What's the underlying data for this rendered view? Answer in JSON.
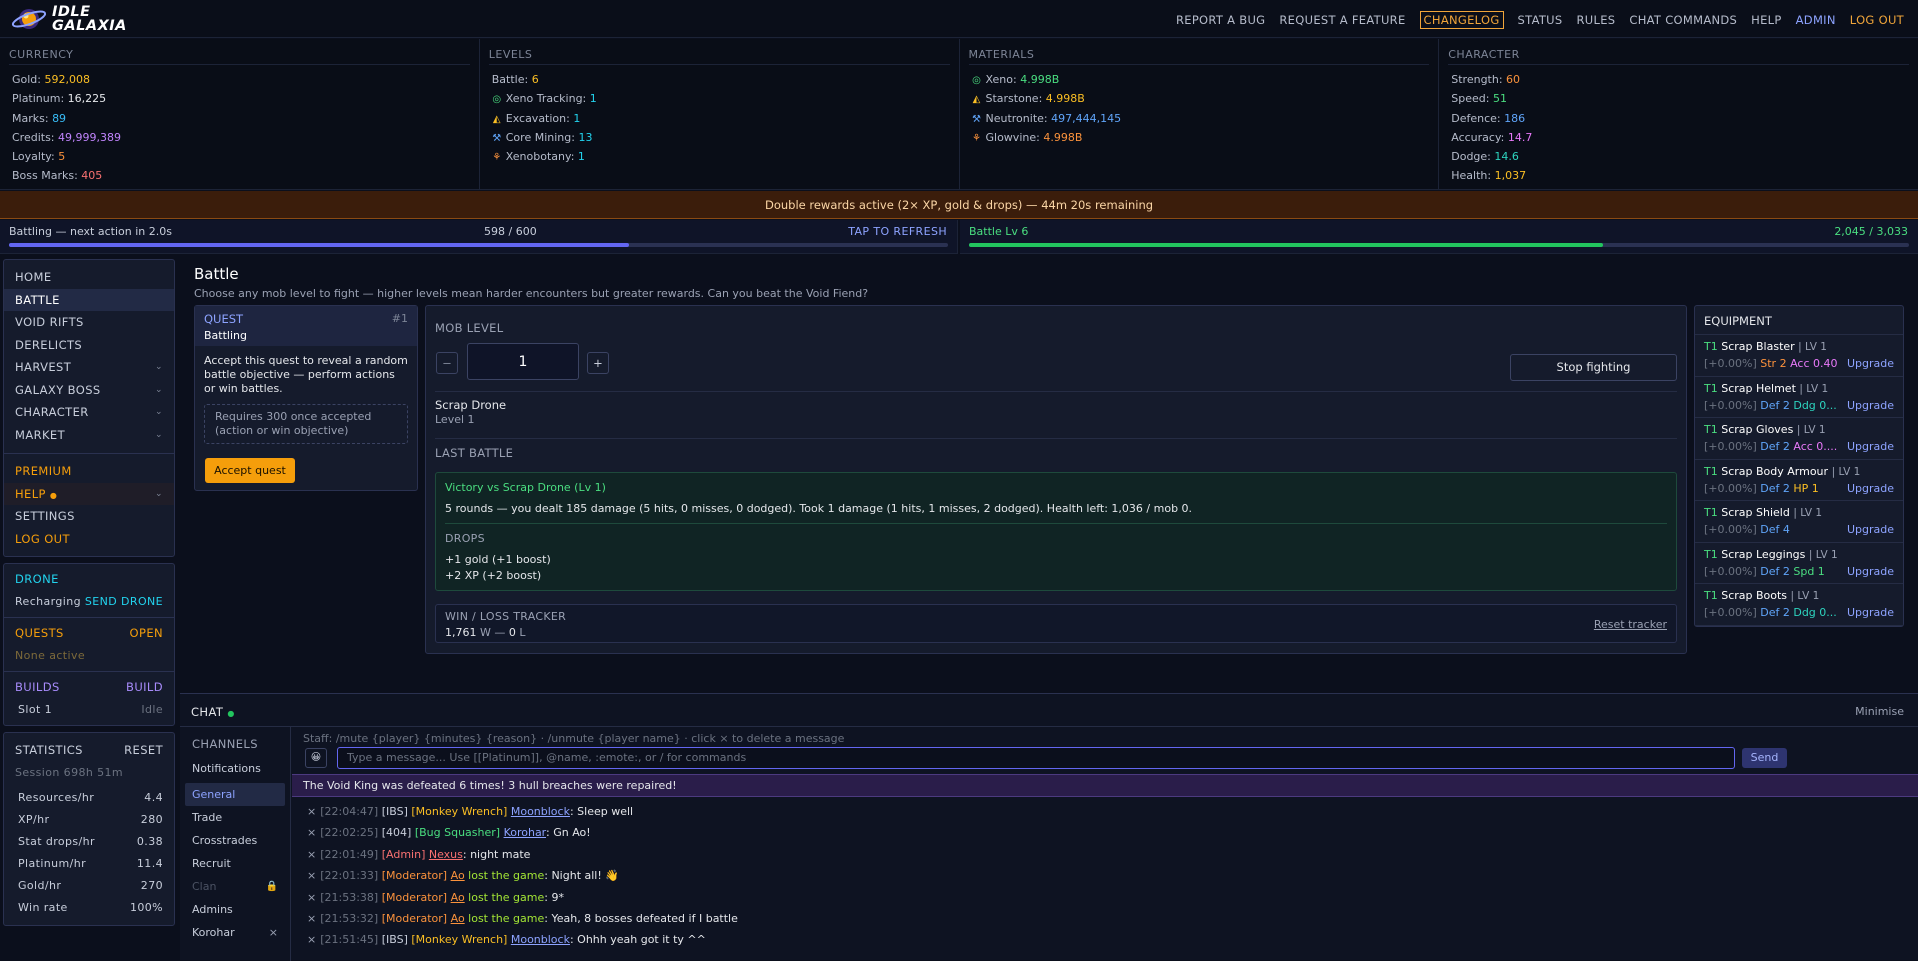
{
  "brand": {
    "line1": "IDLE",
    "line2": "GALAXIA"
  },
  "nav": [
    "REPORT A BUG",
    "REQUEST A FEATURE",
    "CHANGELOG",
    "STATUS",
    "RULES",
    "CHAT COMMANDS",
    "HELP",
    "ADMIN",
    "LOG OUT"
  ],
  "currency": {
    "title": "CURRENCY",
    "rows": [
      {
        "k": "Gold:",
        "v": "592,008",
        "c": "#fbbf24"
      },
      {
        "k": "Platinum:",
        "v": "16,225",
        "c": "#e5e7eb"
      },
      {
        "k": "Marks:",
        "v": "89",
        "c": "#38bdf8"
      },
      {
        "k": "Credits:",
        "v": "49,999,389",
        "c": "#c084fc"
      },
      {
        "k": "Loyalty:",
        "v": "5",
        "c": "#fb923c"
      },
      {
        "k": "Boss Marks:",
        "v": "405",
        "c": "#f87171"
      }
    ]
  },
  "levels": {
    "title": "LEVELS",
    "rows": [
      {
        "icon": "",
        "k": "Battle:",
        "v": "6",
        "c": "#fbbf24"
      },
      {
        "icon": "◎",
        "ic": "#4ade80",
        "k": "Xeno Tracking:",
        "v": "1",
        "c": "#22d3ee"
      },
      {
        "icon": "◭",
        "ic": "#fbbf24",
        "k": "Excavation:",
        "v": "1",
        "c": "#22d3ee"
      },
      {
        "icon": "⚒",
        "ic": "#60a5fa",
        "k": "Core Mining:",
        "v": "13",
        "c": "#22d3ee"
      },
      {
        "icon": "⚘",
        "ic": "#fb923c",
        "k": "Xenobotany:",
        "v": "1",
        "c": "#22d3ee"
      }
    ]
  },
  "materials": {
    "title": "MATERIALS",
    "rows": [
      {
        "icon": "◎",
        "ic": "#4ade80",
        "k": "Xeno:",
        "v": "4.998B",
        "c": "#4ade80"
      },
      {
        "icon": "◭",
        "ic": "#fbbf24",
        "k": "Starstone:",
        "v": "4.998B",
        "c": "#fbbf24"
      },
      {
        "icon": "⚒",
        "ic": "#60a5fa",
        "k": "Neutronite:",
        "v": "497,444,145",
        "c": "#60a5fa"
      },
      {
        "icon": "⚘",
        "ic": "#fb923c",
        "k": "Glowvine:",
        "v": "4.998B",
        "c": "#fb923c"
      }
    ]
  },
  "character": {
    "title": "CHARACTER",
    "rows": [
      {
        "k": "Strength:",
        "v": "60",
        "c": "#fb923c"
      },
      {
        "k": "Speed:",
        "v": "51",
        "c": "#4ade80"
      },
      {
        "k": "Defence:",
        "v": "186",
        "c": "#60a5fa"
      },
      {
        "k": "Accuracy:",
        "v": "14.7",
        "c": "#e879f9"
      },
      {
        "k": "Dodge:",
        "v": "14.6",
        "c": "#2dd4bf"
      },
      {
        "k": "Health:",
        "v": "1,037",
        "c": "#fbbf24"
      }
    ]
  },
  "banner": "Double rewards active (2× XP, gold & drops) — 44m 20s remaining",
  "progress": {
    "action": "Battling — next action in 2.0s",
    "count": "598 / 600",
    "refresh": "TAP TO REFRESH",
    "action_frac": 0.66,
    "level_label": "Battle Lv 6",
    "level_count": "2,045 / 3,033",
    "level_frac": 0.674
  },
  "menu": {
    "main": [
      "HOME",
      "BATTLE",
      "VOID RIFTS",
      "DERELICTS",
      "HARVEST",
      "GALAXY BOSS",
      "CHARACTER",
      "MARKET"
    ],
    "extra": [
      "PREMIUM",
      "HELP",
      "SETTINGS",
      "LOG OUT"
    ]
  },
  "drone": {
    "title": "DRONE",
    "status": "Recharging",
    "action": "SEND DRONE"
  },
  "quests": {
    "title": "QUESTS",
    "action": "OPEN",
    "status": "None active"
  },
  "builds": {
    "title": "BUILDS",
    "action": "BUILD",
    "slot": "Slot 1",
    "state": "Idle"
  },
  "statistics": {
    "title": "STATISTICS",
    "reset": "RESET",
    "session": "Session 698h 51m",
    "rows": [
      {
        "k": "Resources/hr",
        "v": "4.4"
      },
      {
        "k": "XP/hr",
        "v": "280"
      },
      {
        "k": "Stat drops/hr",
        "v": "0.38"
      },
      {
        "k": "Platinum/hr",
        "v": "11.4"
      },
      {
        "k": "Gold/hr",
        "v": "270"
      },
      {
        "k": "Win rate",
        "v": "100%"
      }
    ]
  },
  "page": {
    "title": "Battle",
    "subtitle": "Choose any mob level to fight — higher levels mean harder encounters but greater rewards. Can you beat the Void Fiend?"
  },
  "quest_card": {
    "label": "QUEST",
    "num": "#1",
    "type": "Battling",
    "desc": "Accept this quest to reveal a random battle objective — perform actions or win battles.",
    "req": "Requires 300 once accepted (action or win objective)",
    "button": "Accept quest"
  },
  "battle": {
    "mob_level_label": "MOB LEVEL",
    "minus": "−",
    "plus": "+",
    "mob_level": "1",
    "stop": "Stop fighting",
    "mob_name": "Scrap Drone",
    "mob_lvl": "Level 1",
    "last_battle": "LAST BATTLE",
    "result": "Victory vs Scrap Drone (Lv 1)",
    "summary": "5 rounds — you dealt 185 damage (5 hits, 0 misses, 0 dodged). Took 1 damage (1 hits, 1 misses, 2 dodged). Health left: 1,036 / mob 0.",
    "drops_label": "DROPS",
    "drops": [
      "+1 gold (+1 boost)",
      "+2 XP (+2 boost)"
    ],
    "tracker_label": "WIN / LOSS TRACKER",
    "wins": "1,761",
    "w": "W",
    "dash": "—",
    "losses": "0",
    "l": "L",
    "reset": "Reset tracker"
  },
  "equipment": {
    "title": "EQUIPMENT",
    "upgrade": "Upgrade",
    "items": [
      {
        "tier": "T1",
        "name": "Scrap Blaster",
        "lv": "| LV 1",
        "pct": "[+0.00%]",
        "stats": [
          {
            "t": "Str 2",
            "c": "#fb923c"
          },
          {
            "t": "Acc 0.40",
            "c": "#e879f9"
          }
        ]
      },
      {
        "tier": "T1",
        "name": "Scrap Helmet",
        "lv": "| LV 1",
        "pct": "[+0.00%]",
        "stats": [
          {
            "t": "Def 2",
            "c": "#60a5fa"
          },
          {
            "t": "Ddg 0...",
            "c": "#2dd4bf"
          }
        ]
      },
      {
        "tier": "T1",
        "name": "Scrap Gloves",
        "lv": "| LV 1",
        "pct": "[+0.00%]",
        "stats": [
          {
            "t": "Def 2",
            "c": "#60a5fa"
          },
          {
            "t": "Acc 0....",
            "c": "#e879f9"
          }
        ]
      },
      {
        "tier": "T1",
        "name": "Scrap Body Armour",
        "lv": "| LV 1",
        "pct": "[+0.00%]",
        "stats": [
          {
            "t": "Def 2",
            "c": "#60a5fa"
          },
          {
            "t": "HP 1",
            "c": "#fbbf24"
          }
        ]
      },
      {
        "tier": "T1",
        "name": "Scrap Shield",
        "lv": "| LV 1",
        "pct": "[+0.00%]",
        "stats": [
          {
            "t": "Def 4",
            "c": "#60a5fa"
          }
        ]
      },
      {
        "tier": "T1",
        "name": "Scrap Leggings",
        "lv": "| LV 1",
        "pct": "[+0.00%]",
        "stats": [
          {
            "t": "Def 2",
            "c": "#60a5fa"
          },
          {
            "t": "Spd 1",
            "c": "#4ade80"
          }
        ]
      },
      {
        "tier": "T1",
        "name": "Scrap Boots",
        "lv": "| LV 1",
        "pct": "[+0.00%]",
        "stats": [
          {
            "t": "Def 2",
            "c": "#60a5fa"
          },
          {
            "t": "Ddg 0...",
            "c": "#2dd4bf"
          }
        ]
      }
    ]
  },
  "chat": {
    "title": "CHAT",
    "minimise": "Minimise",
    "channels_label": "CHANNELS",
    "channels": [
      "Notifications",
      "General",
      "Trade",
      "Crosstrades",
      "Recruit",
      "Clan",
      "Admins",
      "Korohar"
    ],
    "staff_hint": "Staff: /mute {player} {minutes} {reason} · /unmute {player name} · click × to delete a message",
    "emoji": "😀",
    "placeholder": "Type a message... Use [[Platinum]], @name, :emote:, or / for commands",
    "send": "Send",
    "announcement": "The Void King was defeated 6 times! 3 hull breaches were repaired!",
    "messages": [
      {
        "t": "[22:04:47]",
        "tag": "[IBS]",
        "tc": "#c8cedb",
        "role": "[Monkey Wrench]",
        "rc": "#fbbf24",
        "user": "Moonblock",
        "uc": "#8da3ff",
        "pre": "",
        "text": ": Sleep well"
      },
      {
        "t": "[22:02:25]",
        "tag": "[404]",
        "tc": "#c8cedb",
        "role": "[Bug Squasher]",
        "rc": "#4ade80",
        "user": "Korohar",
        "uc": "#8da3ff",
        "pre": "",
        "text": ": Gn Ao!"
      },
      {
        "t": "[22:01:49]",
        "tag": "",
        "tc": "",
        "role": "[Admin]",
        "rc": "#f87171",
        "user": "Nexus",
        "uc": "#f87171",
        "pre": "",
        "text": ": night mate"
      },
      {
        "t": "[22:01:33]",
        "tag": "",
        "tc": "",
        "role": "[Moderator]",
        "rc": "#fb923c",
        "user": "Ao",
        "uc": "#fb923c",
        "pre": " lost the game",
        "text": ": Night all! 👋"
      },
      {
        "t": "[21:53:38]",
        "tag": "",
        "tc": "",
        "role": "[Moderator]",
        "rc": "#fb923c",
        "user": "Ao",
        "uc": "#fb923c",
        "pre": " lost the game",
        "text": ": 9*"
      },
      {
        "t": "[21:53:32]",
        "tag": "",
        "tc": "",
        "role": "[Moderator]",
        "rc": "#fb923c",
        "user": "Ao",
        "uc": "#fb923c",
        "pre": " lost the game",
        "text": ": Yeah, 8 bosses defeated if I battle"
      },
      {
        "t": "[21:51:45]",
        "tag": "[IBS]",
        "tc": "#c8cedb",
        "role": "[Monkey Wrench]",
        "rc": "#fbbf24",
        "user": "Moonblock",
        "uc": "#8da3ff",
        "pre": "",
        "text": ": Ohhh yeah got it ty ^^"
      }
    ]
  }
}
